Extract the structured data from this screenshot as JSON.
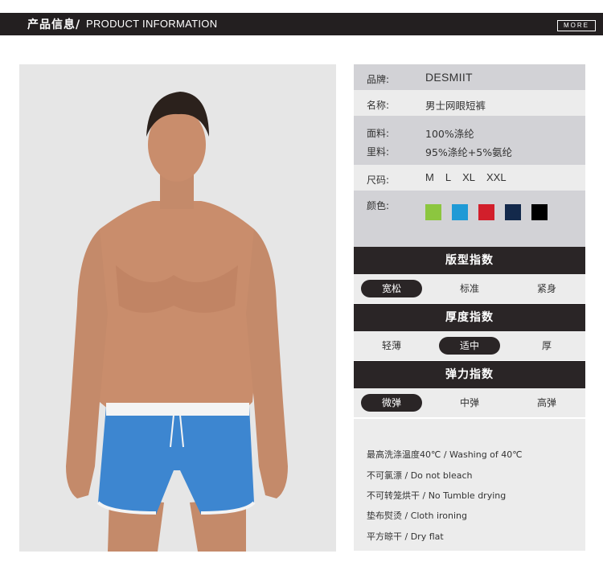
{
  "header": {
    "title_cn": "产品信息/",
    "title_en": "PRODUCT INFORMATION",
    "more_label": "MORE"
  },
  "product": {
    "brand_label": "品牌:",
    "brand": "DESMIIT",
    "name_label": "名称:",
    "name": "男士网眼短裤",
    "fabric_label": "面料:",
    "fabric": "100%涤纶",
    "lining_label": "里料:",
    "lining": "95%涤纶+5%氨纶",
    "size_label": "尺码:",
    "sizes": [
      "M",
      "L",
      "XL",
      "XXL"
    ],
    "color_label": "颜色:",
    "colors": [
      "#8cc63f",
      "#1f9ad6",
      "#d21f2b",
      "#13294b",
      "#000000"
    ]
  },
  "indexes": [
    {
      "title": "版型指数",
      "options": [
        "宽松",
        "标准",
        "紧身"
      ],
      "selected": "宽松"
    },
    {
      "title": "厚度指数",
      "options": [
        "轻薄",
        "适中",
        "厚"
      ],
      "selected": "适中"
    },
    {
      "title": "弹力指数",
      "options": [
        "微弹",
        "中弹",
        "高弹"
      ],
      "selected": "微弹"
    }
  ],
  "care": [
    "最高洗涤温度40℃ / Washing of 40℃",
    "不可氯漂 / Do not bleach",
    "不可转笼烘干 / No Tumble drying",
    "垫布熨烫 / Cloth ironing",
    "平方晾干 / Dry flat"
  ]
}
